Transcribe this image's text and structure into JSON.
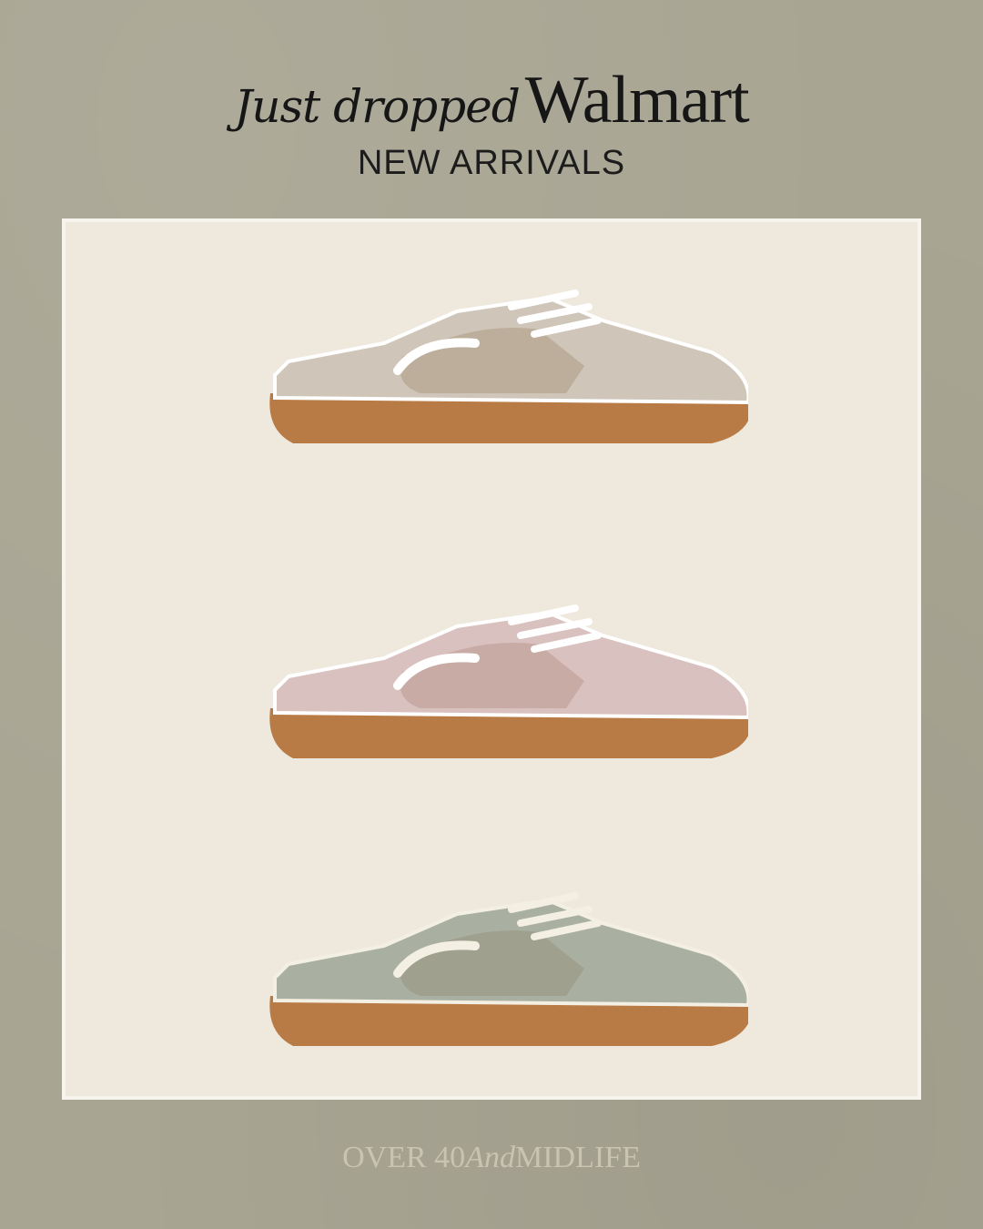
{
  "header": {
    "script_text": "Just dropped",
    "brand_text": "Walmart",
    "subtitle": "NEW ARRIVALS"
  },
  "products": [
    {
      "name": "taupe mesh sneaker mule",
      "upper_color": "#cfc5b8",
      "mesh_color": "#b9ab98",
      "trim_color": "#ffffff",
      "sole_color": "#b87b45"
    },
    {
      "name": "blush mesh sneaker mule",
      "upper_color": "#d9c1bf",
      "mesh_color": "#c6a9a3",
      "trim_color": "#ffffff",
      "sole_color": "#b87b45"
    },
    {
      "name": "sage mesh sneaker mule",
      "upper_color": "#a9b0a2",
      "mesh_color": "#9e9f8d",
      "trim_color": "#f4efe3",
      "sole_color": "#b87b45"
    }
  ],
  "watermark": {
    "left": "OVER 40",
    "middle": "And",
    "right": "MIDLIFE"
  },
  "colors": {
    "background": "#a9a593",
    "card": "#efe9dd",
    "card_border": "#f7f4ee",
    "text": "#161616"
  }
}
